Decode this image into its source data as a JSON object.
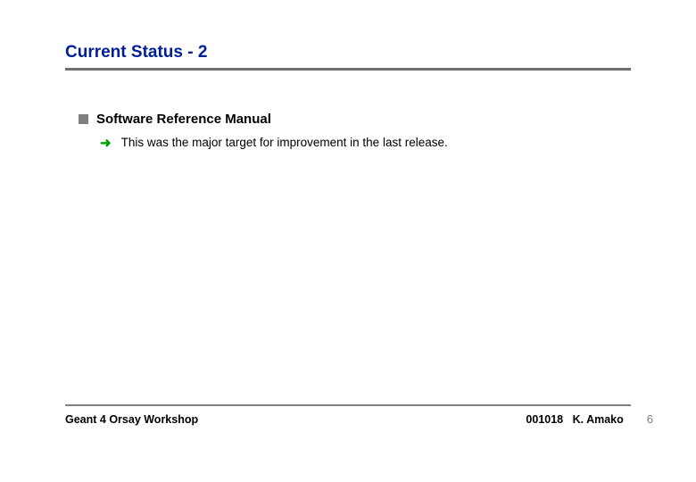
{
  "title": "Current Status - 2",
  "content": {
    "l1_items": [
      {
        "label": "Software Reference Manual",
        "l2_items": [
          "This was the major target for improvement in the last release."
        ]
      }
    ]
  },
  "footer": {
    "left": "Geant 4 Orsay Workshop",
    "date": "001018",
    "author": "K. Amako",
    "page": "6"
  },
  "icons": {
    "arrow": "➜"
  }
}
